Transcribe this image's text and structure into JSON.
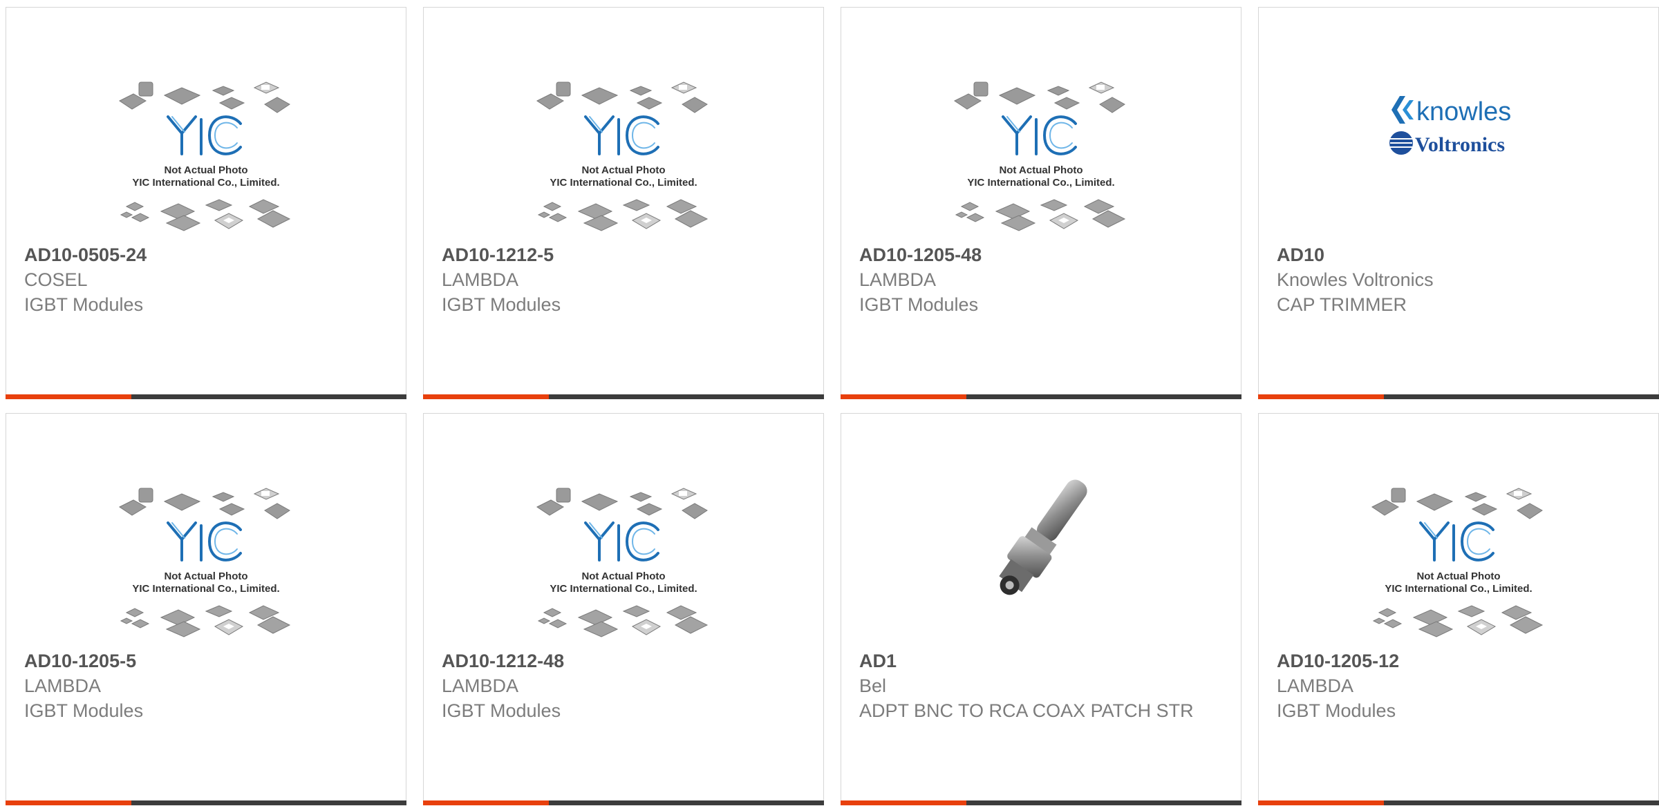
{
  "placeholder_image": {
    "line1": "Not Actual Photo",
    "line2": "YIC International Co., Limited."
  },
  "knowles_logo": {
    "word1": "knowles",
    "word2": "Voltronics"
  },
  "colors": {
    "accent": "#e8400d",
    "bar": "#3c3c3c",
    "yic_blue": "#1e6fb5"
  },
  "products": [
    {
      "part_number": "AD10-0505-24",
      "manufacturer": "COSEL",
      "description": "IGBT Modules",
      "image": "yic-placeholder"
    },
    {
      "part_number": "AD10-1212-5",
      "manufacturer": "LAMBDA",
      "description": "IGBT Modules",
      "image": "yic-placeholder"
    },
    {
      "part_number": "AD10-1205-48",
      "manufacturer": "LAMBDA",
      "description": "IGBT Modules",
      "image": "yic-placeholder"
    },
    {
      "part_number": "AD10",
      "manufacturer": "Knowles Voltronics",
      "description": "CAP TRIMMER",
      "image": "knowles-voltronics-logo"
    },
    {
      "part_number": "AD10-1205-5",
      "manufacturer": "LAMBDA",
      "description": "IGBT Modules",
      "image": "yic-placeholder"
    },
    {
      "part_number": "AD10-1212-48",
      "manufacturer": "LAMBDA",
      "description": "IGBT Modules",
      "image": "yic-placeholder"
    },
    {
      "part_number": "AD1",
      "manufacturer": "Bel",
      "description": "ADPT BNC TO RCA COAX PATCH STR",
      "image": "bnc-adapter-photo"
    },
    {
      "part_number": "AD10-1205-12",
      "manufacturer": "LAMBDA",
      "description": "IGBT Modules",
      "image": "yic-placeholder"
    }
  ]
}
